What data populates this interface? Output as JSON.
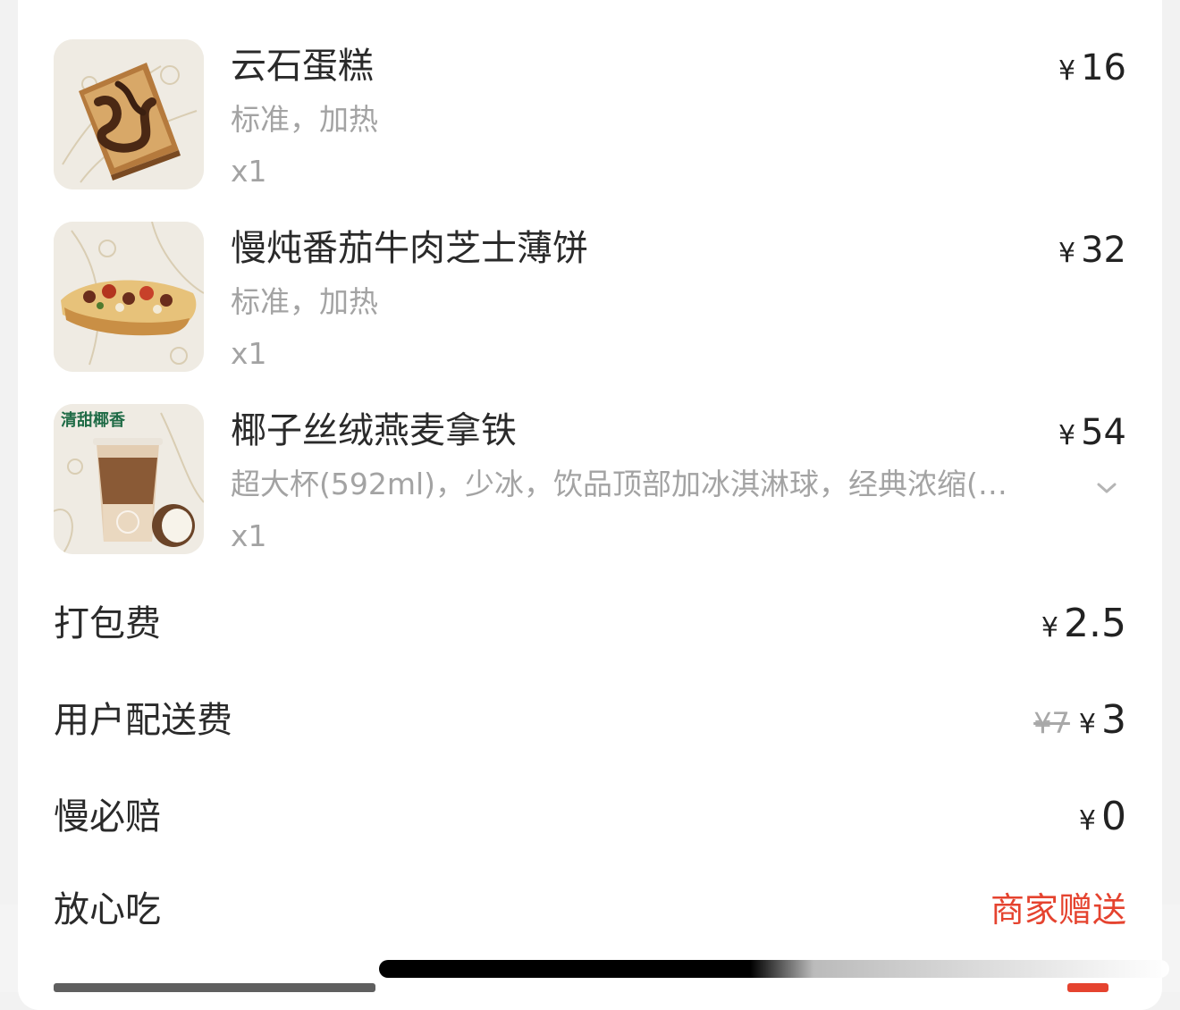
{
  "order_items": [
    {
      "name": "云石蛋糕",
      "spec": "标准，加热",
      "qty": "x1",
      "currency": "¥",
      "price": "16",
      "image_icon": "marble-cake-image"
    },
    {
      "name": "慢炖番茄牛肉芝士薄饼",
      "spec": "标准，加热",
      "qty": "x1",
      "currency": "¥",
      "price": "32",
      "image_icon": "beef-flatbread-image"
    },
    {
      "name": "椰子丝绒燕麦拿铁",
      "spec": "超大杯(592ml)，少冰，饮品顶部加冰淇淋球，经典浓缩(…",
      "qty": "x1",
      "currency": "¥",
      "price": "54",
      "image_icon": "coconut-latte-image",
      "image_tag": "清甜椰香"
    }
  ],
  "fees": {
    "packing": {
      "label": "打包费",
      "currency": "¥",
      "value": "2.5"
    },
    "delivery": {
      "label": "用户配送费",
      "original": "¥7",
      "currency": "¥",
      "value": "3"
    },
    "late_compensation": {
      "label": "慢必赔",
      "currency": "¥",
      "value": "0"
    },
    "safe_eat": {
      "label": "放心吃",
      "value": "商家赠送"
    }
  },
  "colors": {
    "accent_red": "#e5432f",
    "muted_text": "#a3a3a3",
    "primary_text": "#2a2a2a"
  }
}
